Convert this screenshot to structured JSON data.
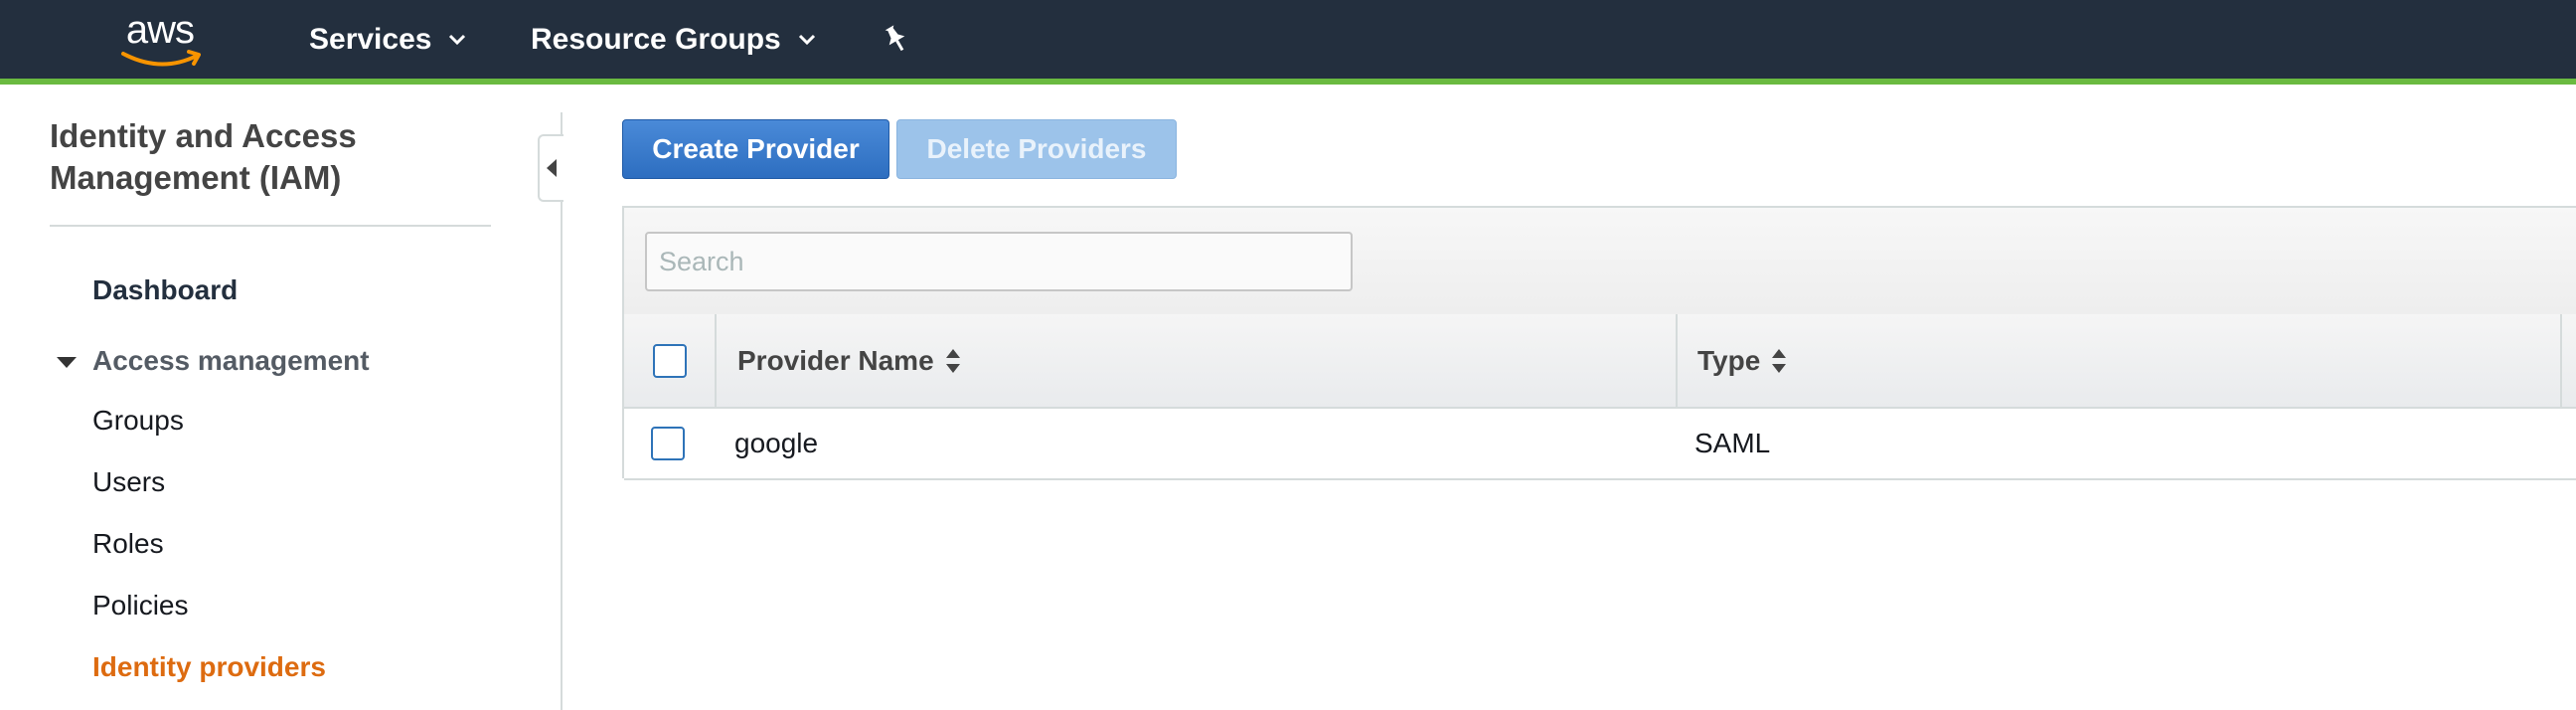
{
  "topnav": {
    "logo_text": "aws",
    "services_label": "Services",
    "resource_groups_label": "Resource Groups",
    "pin_icon": "pushpin-icon",
    "accent_color": "#6aba40",
    "background_color": "#232f3e"
  },
  "sidebar": {
    "title": "Identity and Access Management (IAM)",
    "dashboard_label": "Dashboard",
    "section_label": "Access management",
    "items": [
      {
        "label": "Groups"
      },
      {
        "label": "Users"
      },
      {
        "label": "Roles"
      },
      {
        "label": "Policies"
      },
      {
        "label": "Identity providers",
        "active": true
      }
    ],
    "active_color": "#dd6b10"
  },
  "toolbar": {
    "create_label": "Create Provider",
    "delete_label": "Delete Providers"
  },
  "search": {
    "placeholder": "Search",
    "value": ""
  },
  "table": {
    "columns": [
      "Provider Name",
      "Type"
    ],
    "rows": [
      {
        "name": "google",
        "type": "SAML"
      }
    ]
  }
}
